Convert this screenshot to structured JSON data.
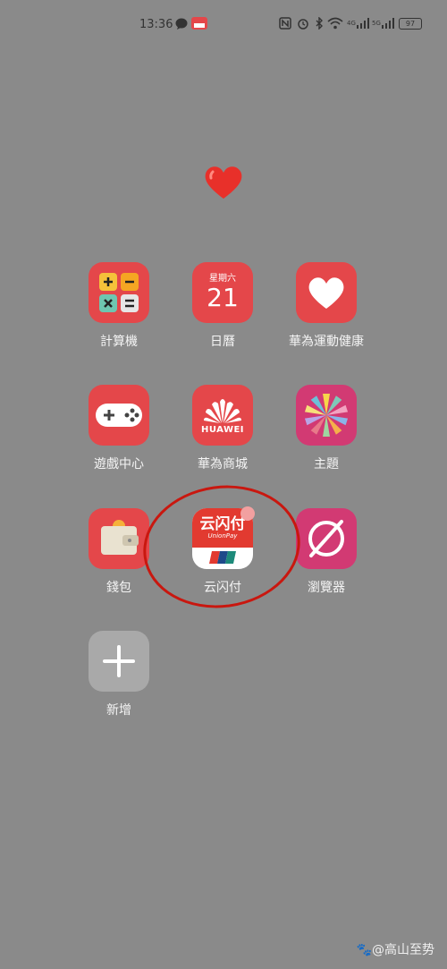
{
  "status_bar": {
    "time": "13:36",
    "battery": "97",
    "network_1": "4G",
    "network_2": "5G"
  },
  "apps": [
    {
      "label": "計算機",
      "icon": "calculator-icon"
    },
    {
      "label": "日曆",
      "icon": "calendar-icon",
      "calendar_weekday": "星期六",
      "calendar_day": "21"
    },
    {
      "label": "華為運動健康",
      "icon": "heart-icon"
    },
    {
      "label": "遊戲中心",
      "icon": "gamepad-icon"
    },
    {
      "label": "華為商城",
      "icon": "huawei-icon",
      "brand_text": "HUAWEI"
    },
    {
      "label": "主題",
      "icon": "pinwheel-icon"
    },
    {
      "label": "錢包",
      "icon": "wallet-icon"
    },
    {
      "label": "云闪付",
      "icon": "unionpay-icon",
      "brand_cn": "云闪付",
      "brand_en": "UnionPay"
    },
    {
      "label": "瀏覽器",
      "icon": "compass-icon"
    },
    {
      "label": "新增",
      "icon": "plus-icon"
    }
  ],
  "watermark": "@高山至势",
  "colors": {
    "background": "#8a8a8a",
    "app_red": "#e4474a",
    "highlight": "#c9170f"
  }
}
